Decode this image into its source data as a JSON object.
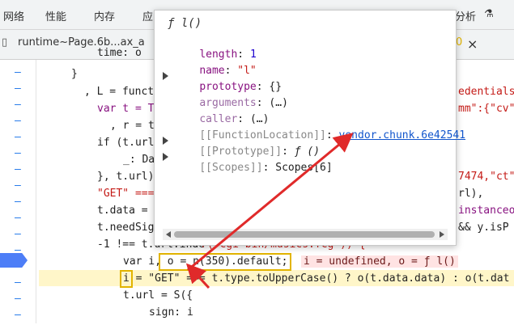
{
  "menu": {
    "items": [
      "网络",
      "性能",
      "内存",
      "应",
      "分析"
    ],
    "hidden_hint": "⚗"
  },
  "tabs": {
    "active_label": "runtime~Page.6b...ax_a",
    "right_label": "0",
    "close_glyph": "×"
  },
  "code": {
    "lines": [
      {
        "text": "time: o"
      },
      {
        "text": "}"
      },
      {
        "text": ", L = funct"
      },
      {
        "text": "var t = T"
      },
      {
        "text": ", r = t"
      },
      {
        "text": "if (t.url"
      },
      {
        "text": "_: Da"
      },
      {
        "text": "}, t.url)"
      },
      {
        "text": "\"GET\" ==="
      },
      {
        "text": "t.data ="
      },
      {
        "text": "t.needSig"
      },
      {
        "text": "-1 !== t.url.inde"
      },
      {
        "text": "var i, o = n(350).default;"
      },
      {
        "text": "i = \"GET\" === t.type.toUpperCase() ? o(t.data.data) : o(t.dat"
      },
      {
        "text": "t.url = S({"
      },
      {
        "text": "sign: i"
      }
    ],
    "right_fragments": [
      "edentials",
      "mm\":{\"cv\"",
      "7474,\"ct\"",
      "rl),",
      "instanceo",
      "&& y.isP"
    ],
    "url_fragment": "r( cgi-bin/musics.fcg )) {",
    "inline_value": "i = undefined, o = ƒ l()"
  },
  "popup": {
    "title": "ƒ l()",
    "rows": [
      {
        "key": "length",
        "sep": ": ",
        "value": "1"
      },
      {
        "key": "name",
        "sep": ": ",
        "value": "\"l\""
      },
      {
        "key": "prototype",
        "sep": ": ",
        "value": "{}"
      },
      {
        "key": "arguments",
        "sep": ": ",
        "value": "(…)"
      },
      {
        "key": "caller",
        "sep": ": ",
        "value": "(…)"
      },
      {
        "key": "[[FunctionLocation]]",
        "sep": ": ",
        "value": "vendor.chunk.6e42541"
      },
      {
        "key": "[[Prototype]]",
        "sep": ": ",
        "value": "ƒ ()"
      },
      {
        "key": "[[Scopes]]",
        "sep": ": ",
        "value": "Scopes[6]"
      }
    ]
  },
  "colors": {
    "annotation_red": "#e02a2a",
    "highlight_yellow": "#fff6c9",
    "breakpoint_blue": "#4d7ef7"
  }
}
